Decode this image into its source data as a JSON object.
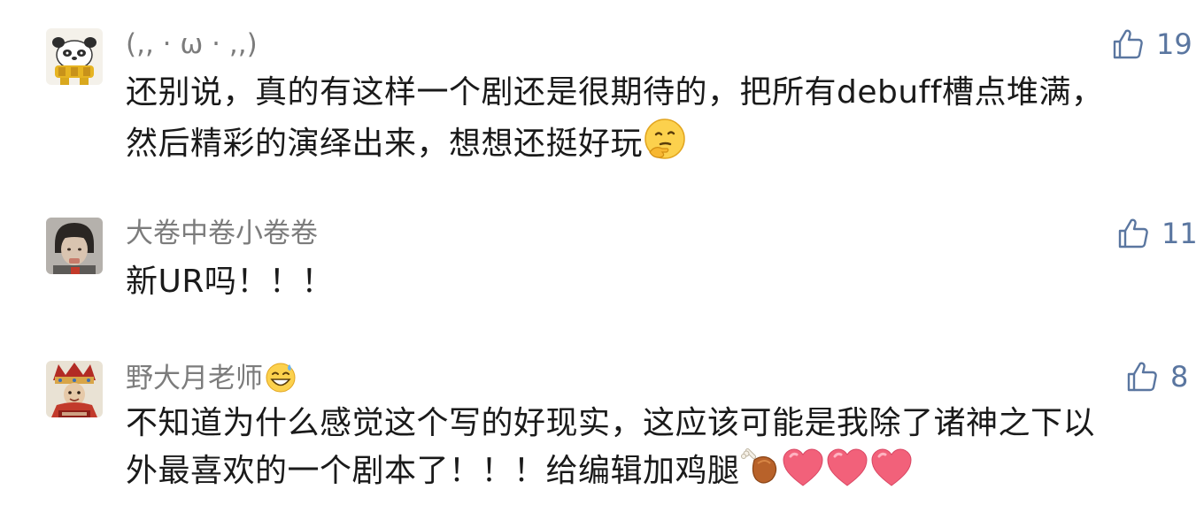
{
  "comments": [
    {
      "avatar": "panda-avatar",
      "username": "(,, · ω · ,,)",
      "likes": "19",
      "lines": [
        "还别说，真的有这样一个剧还是很期待的，把所有debuff槽点堆满，",
        "然后精彩的演绎出来，想想还挺好玩"
      ],
      "trailing_emoji": "thinking-face-emoji"
    },
    {
      "avatar": "person-photo-avatar",
      "username": "大卷中卷小卷卷",
      "likes": "11",
      "lines": [
        "新UR吗！！！"
      ]
    },
    {
      "avatar": "costume-figure-avatar",
      "username": "野大月老师",
      "username_emoji": "grinning-sweat-emoji",
      "likes": "8",
      "lines": [
        "不知道为什么感觉这个写的好现实，这应该可能是我除了诸神之下以",
        "外最喜欢的一个剧本了！！！给编辑加鸡腿"
      ],
      "trailing_emojis": [
        "drumstick-emoji",
        "heart-emoji",
        "heart-emoji",
        "heart-emoji"
      ]
    }
  ],
  "colors": {
    "username": "#7c7c7c",
    "like": "#5a76a0",
    "text": "#1a1a1a"
  }
}
